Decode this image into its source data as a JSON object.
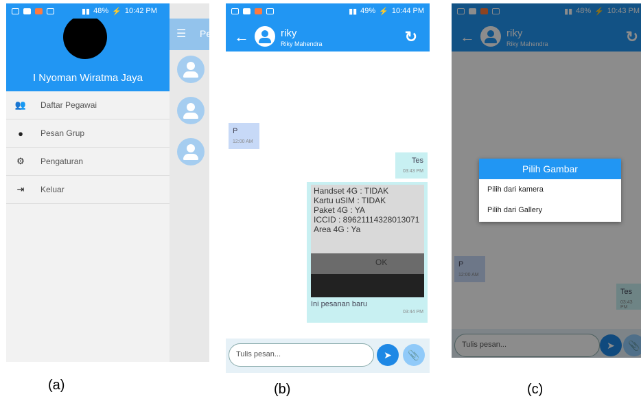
{
  "status_a": {
    "battery": "48%",
    "time": "10:42 PM"
  },
  "status_b": {
    "battery": "49%",
    "time": "10:44 PM"
  },
  "status_c": {
    "battery": "48%",
    "time": "10:43 PM"
  },
  "drawer": {
    "user_name": "I Nyoman Wiratma Jaya",
    "menu": [
      {
        "label": "Daftar Pegawai",
        "icon": "people-icon"
      },
      {
        "label": "Pesan Grup",
        "icon": "chat-bubble-icon"
      },
      {
        "label": "Pengaturan",
        "icon": "gear-icon"
      },
      {
        "label": "Keluar",
        "icon": "logout-icon"
      }
    ],
    "behind_title": "Pe"
  },
  "chat": {
    "title": "riky",
    "subtitle": "Riky Mahendra",
    "messages": [
      {
        "text": "P",
        "time": "12:00 AM",
        "dir": "in"
      },
      {
        "text": "Tes",
        "time": "03:43 PM",
        "dir": "out"
      },
      {
        "text": "Ini pesanan baru",
        "time": "03:44 PM",
        "dir": "out",
        "has_image": true
      }
    ],
    "photo_lines": [
      "Handset 4G : TIDAK",
      "Kartu uSIM : TIDAK",
      "Paket 4G : YA",
      "ICCID : 89621114328013071",
      "Area 4G : Ya"
    ],
    "photo_ok": "OK",
    "input_placeholder": "Tulis pesan..."
  },
  "dialog": {
    "title": "Pilih Gambar",
    "options": [
      "Pilih dari kamera",
      "Pilih dari Gallery"
    ]
  },
  "captions": [
    "(a)",
    "(b)",
    "(c)"
  ]
}
